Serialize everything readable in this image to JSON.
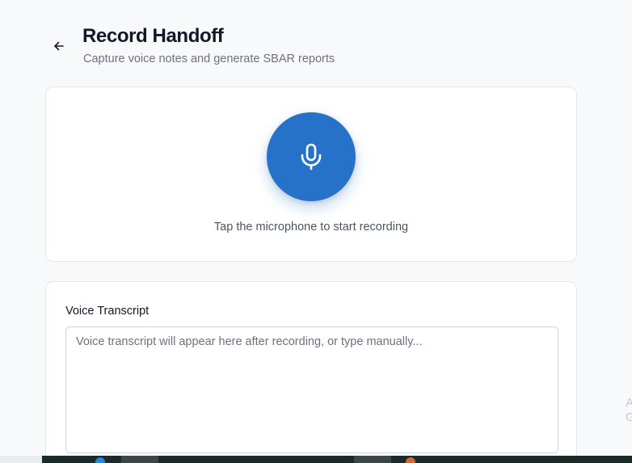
{
  "header": {
    "title": "Record Handoff",
    "subtitle": "Capture voice notes and generate SBAR reports",
    "back_icon": "arrow-left-icon"
  },
  "recorder": {
    "mic_icon": "microphone-icon",
    "hint": "Tap the microphone to start recording",
    "accent_color": "#2672c9"
  },
  "transcript": {
    "label": "Voice Transcript",
    "value": "",
    "placeholder": "Voice transcript will appear here after recording, or type manually..."
  },
  "side_fragment": {
    "line1": "A",
    "line2": "G"
  }
}
